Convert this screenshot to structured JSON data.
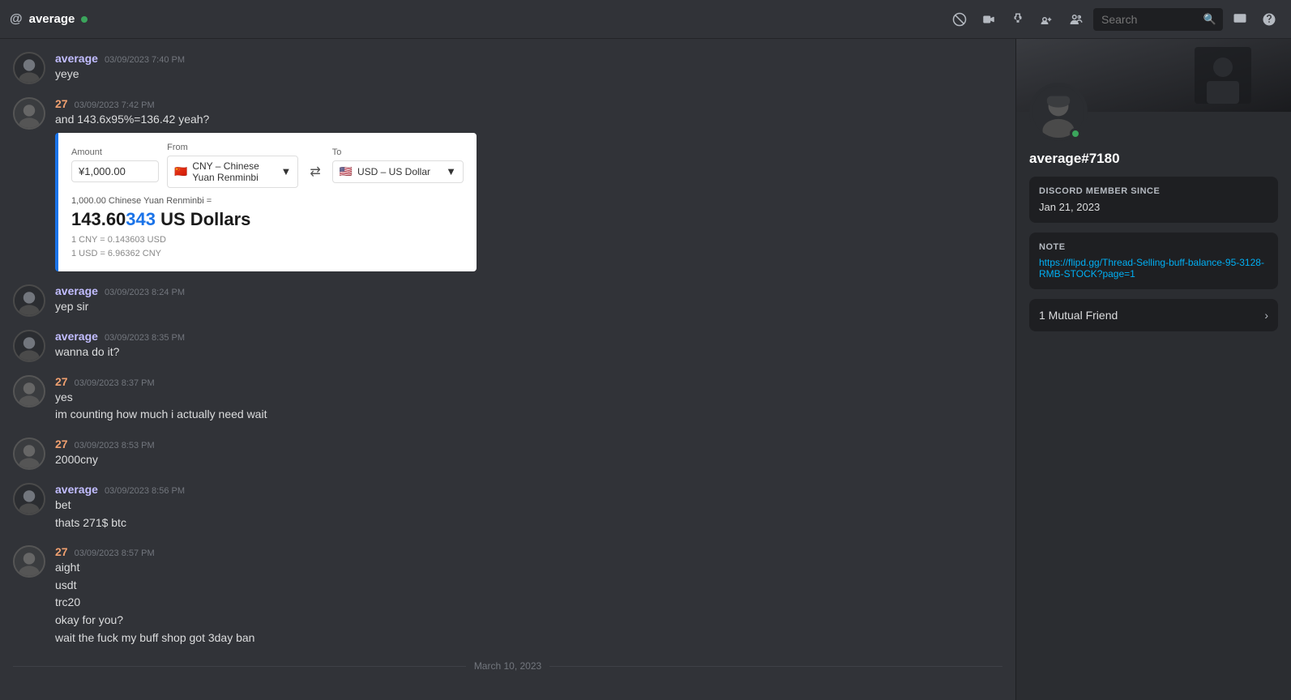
{
  "topbar": {
    "channel_at_icon": "@",
    "channel_name": "average",
    "status": "online",
    "icons": [
      "phone-icon",
      "video-icon",
      "pin-icon",
      "add-member-icon",
      "members-icon"
    ],
    "search_placeholder": "Search"
  },
  "messages": [
    {
      "id": "msg1",
      "author": "average",
      "author_type": "average",
      "timestamp": "03/09/2023 7:40 PM",
      "lines": [
        "yeye"
      ]
    },
    {
      "id": "msg2",
      "author": "27",
      "author_type": "27",
      "timestamp": "03/09/2023 7:42 PM",
      "lines": [
        "and 143.6x95%=136.42 yeah?"
      ],
      "embed": {
        "type": "currency",
        "amount_label": "Amount",
        "from_label": "From",
        "to_label": "To",
        "amount_value": "¥1,000.00",
        "from_currency": "CNY – Chinese Yuan Renminbi",
        "from_flag": "🇨🇳",
        "to_currency": "USD – US Dollar",
        "to_flag": "🇺🇸",
        "result_label": "1,000.00 Chinese Yuan Renminbi =",
        "result_main_text": "143.60",
        "result_highlight": "343",
        "result_unit": " US Dollars",
        "rate1": "1 CNY = 0.143603 USD",
        "rate2": "1 USD = 6.96362 CNY"
      }
    },
    {
      "id": "msg3",
      "author": "average",
      "author_type": "average",
      "timestamp": "03/09/2023 8:24 PM",
      "lines": [
        "yep sir"
      ]
    },
    {
      "id": "msg4",
      "author": "average",
      "author_type": "average",
      "timestamp": "03/09/2023 8:35 PM",
      "lines": [
        "wanna do it?"
      ]
    },
    {
      "id": "msg5",
      "author": "27",
      "author_type": "27",
      "timestamp": "03/09/2023 8:37 PM",
      "lines": [
        "yes",
        "im counting how much i actually need wait"
      ]
    },
    {
      "id": "msg6",
      "author": "27",
      "author_type": "27",
      "timestamp": "03/09/2023 8:53 PM",
      "lines": [
        "2000cny"
      ]
    },
    {
      "id": "msg7",
      "author": "average",
      "author_type": "average",
      "timestamp": "03/09/2023 8:56 PM",
      "lines": [
        "bet",
        "thats 271$ btc"
      ]
    },
    {
      "id": "msg8",
      "author": "27",
      "author_type": "27",
      "timestamp": "03/09/2023 8:57 PM",
      "lines": [
        "aight",
        "usdt",
        "trc20",
        "okay for you?",
        "wait the fuck my buff shop got 3day ban"
      ]
    }
  ],
  "date_divider": "March 10, 2023",
  "sidebar": {
    "username": "average#7180",
    "discord_member_since_label": "DISCORD MEMBER SINCE",
    "discord_member_since": "Jan 21, 2023",
    "note_label": "NOTE",
    "note_value": "https://flipd.gg/Thread-Selling-buff-balance-95-3128-RMB-STOCK?page=1",
    "mutual_friend_label": "1 Mutual Friend"
  }
}
